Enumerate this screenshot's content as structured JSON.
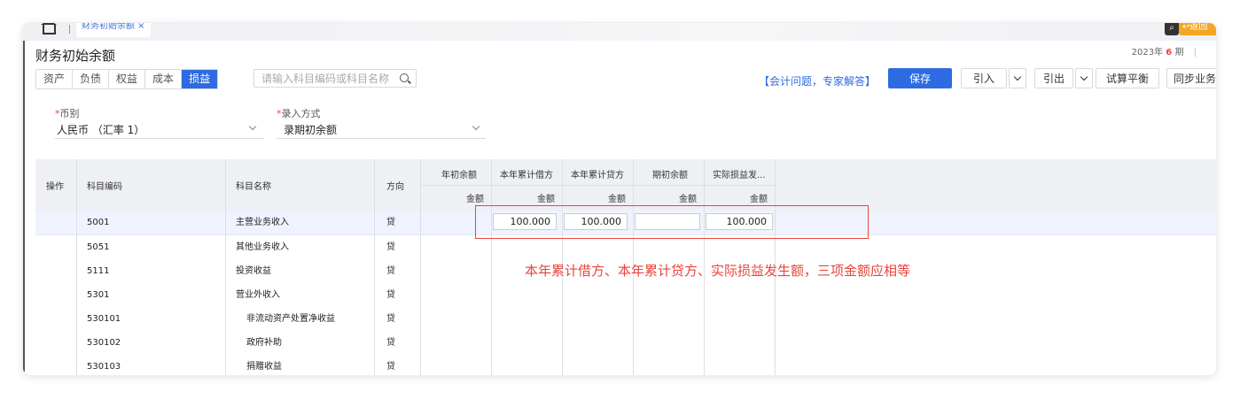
{
  "tabbar": {
    "page_tab": "财务初始余额 ×",
    "orange_button": "↩返回"
  },
  "page": {
    "title": "财务初始余额",
    "period_year": "2023年",
    "period_num": "6",
    "period_unit": "期"
  },
  "subject_tabs": [
    "资产",
    "负债",
    "权益",
    "成本",
    "损益"
  ],
  "search": {
    "placeholder": "请输入科目编码或科目名称"
  },
  "toolbar": {
    "help": "【会计问题，专家解答】",
    "save": "保存",
    "import": "引入",
    "export": "引出",
    "trial_balance": "试算平衡",
    "sync": "同步业务"
  },
  "filters": {
    "currency_label": "币别",
    "currency_value": "人民币 （汇率 1）",
    "entry_label": "录入方式",
    "entry_value": "录期初余额"
  },
  "table": {
    "headers": {
      "op": "操作",
      "code": "科目编码",
      "name": "科目名称",
      "dir": "方向",
      "g1": "年初余额",
      "g2": "本年累计借方",
      "g3": "本年累计贷方",
      "g4": "期初余额",
      "g5": "实际损益发...",
      "sub": "金额"
    },
    "rows": [
      {
        "code": "5001",
        "name": "主营业务收入",
        "dir": "贷",
        "debit": "100.000",
        "credit": "100.000",
        "opening": "",
        "actual": "100.000"
      },
      {
        "code": "5051",
        "name": "其他业务收入",
        "dir": "贷"
      },
      {
        "code": "5111",
        "name": "投资收益",
        "dir": "贷"
      },
      {
        "code": "5301",
        "name": "营业外收入",
        "dir": "贷"
      },
      {
        "code": "530101",
        "name": "非流动资产处置净收益",
        "dir": "贷"
      },
      {
        "code": "530102",
        "name": "政府补助",
        "dir": "贷"
      },
      {
        "code": "530103",
        "name": "捐赠收益",
        "dir": "贷"
      }
    ]
  },
  "annotation": {
    "note": "本年累计借方、本年累计贷方、实际损益发生额，三项金额应相等"
  },
  "colors": {
    "primary": "#2f6be0",
    "annotation": "#e8453c"
  }
}
